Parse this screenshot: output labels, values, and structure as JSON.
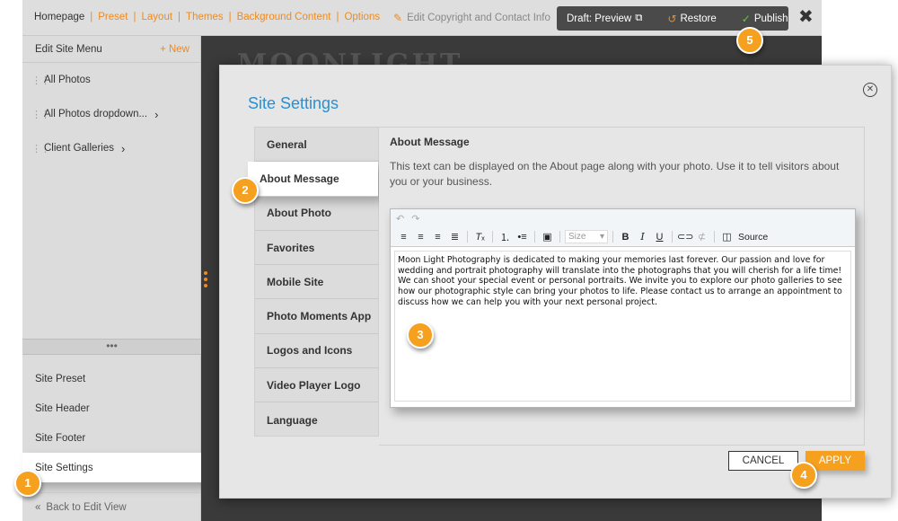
{
  "topbar": {
    "nav": [
      "Homepage",
      "Preset",
      "Layout",
      "Themes",
      "Background Content",
      "Options"
    ],
    "edit_copyright": "Edit Copyright and Contact Info",
    "draft_preview": "Draft: Preview",
    "restore": "Restore",
    "publish": "Publish",
    "close": "✖"
  },
  "sidebar": {
    "title": "Edit Site Menu",
    "new_label": "New",
    "menu_items": [
      {
        "label": "All Photos",
        "chevron": ""
      },
      {
        "label": "All Photos dropdown...",
        "chevron": "›"
      },
      {
        "label": "Client Galleries",
        "chevron": "›"
      }
    ],
    "bottom_items": [
      "Site Preset",
      "Site Header",
      "Site Footer",
      "Site Settings"
    ],
    "back_label": "Back to Edit View"
  },
  "preview": {
    "logo_text": "MOONLIGHT"
  },
  "modal": {
    "title": "Site Settings",
    "tabs": [
      "General",
      "About Message",
      "About Photo",
      "Favorites",
      "Mobile Site",
      "Photo Moments App",
      "Logos and Icons",
      "Video Player Logo",
      "Language"
    ],
    "active_tab": "About Message",
    "heading": "About Message",
    "description": "This text can be displayed on the About page along with your photo. Use it to tell visitors about you or your business.",
    "editor": {
      "size_placeholder": "Size",
      "source_label": "Source",
      "body": "Moon Light Photography is dedicated to making your memories last forever. Our passion and love for wedding and portrait photography will translate into the photographs that you will cherish for a life time! We can shoot your special event or personal portraits. We invite you to explore our photo galleries to see how our photographic style can bring your photos to life. Please contact us to arrange an appointment to discuss how we can help you with your next personal project."
    },
    "cancel_label": "CANCEL",
    "apply_label": "APPLY"
  },
  "badges": [
    "1",
    "2",
    "3",
    "4",
    "5"
  ],
  "colors": {
    "accent": "#f08a1c",
    "title_blue": "#2a8fd1",
    "publish_green": "#6cc24a"
  }
}
